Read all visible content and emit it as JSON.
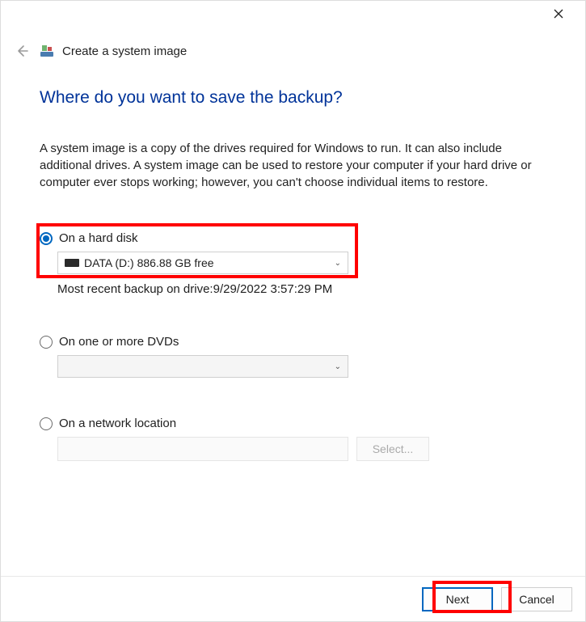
{
  "window": {
    "title": "Create a system image"
  },
  "page": {
    "heading": "Where do you want to save the backup?",
    "description": "A system image is a copy of the drives required for Windows to run. It can also include additional drives. A system image can be used to restore your computer if your hard drive or computer ever stops working; however, you can't choose individual items to restore."
  },
  "options": {
    "hard_disk": {
      "label": "On a hard disk",
      "selected_drive": "DATA (D:)  886.88 GB free",
      "status_prefix": "Most recent backup on drive:",
      "status_time": "9/29/2022 3:57:29 PM"
    },
    "dvd": {
      "label": "On one or more DVDs"
    },
    "network": {
      "label": "On a network location",
      "select_button": "Select..."
    }
  },
  "footer": {
    "next": "Next",
    "cancel": "Cancel"
  }
}
